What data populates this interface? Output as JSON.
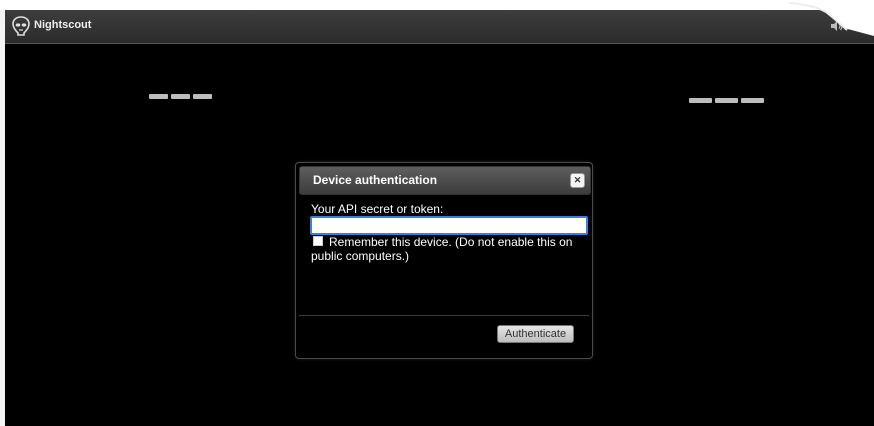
{
  "app": {
    "title": "Nightscout"
  },
  "header": {
    "sound_icon": "speaker-icon",
    "menu_icon": "hamburger-menu-icon"
  },
  "dialog": {
    "title": "Device authentication",
    "close_icon": "close-icon",
    "field_label": "Your API secret or token:",
    "input_value": "",
    "remember_label": "Remember this device. (Do not enable this on public computers.)",
    "remember_checked": false,
    "submit_label": "Authenticate"
  },
  "colors": {
    "background": "#000000",
    "topbar": "#333333",
    "input_focus": "#3b7de0"
  }
}
